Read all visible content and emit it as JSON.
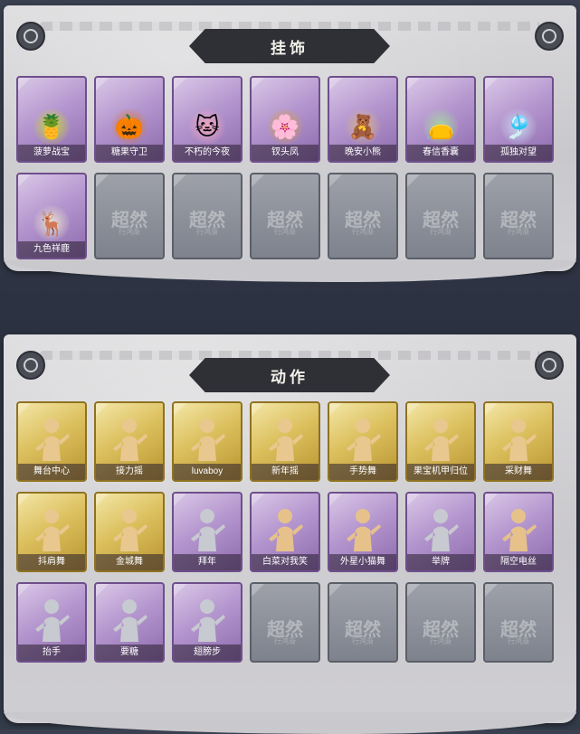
{
  "pendants": {
    "title": "挂饰",
    "items": [
      {
        "label": "菠萝战宝",
        "icon": "pineapple-warrior-icon",
        "glyph": "🍍",
        "color": "#c9d832"
      },
      {
        "label": "糖果守卫",
        "icon": "pumpkin-guard-icon",
        "glyph": "🎃",
        "color": "#e07a2e"
      },
      {
        "label": "不朽的今夜",
        "icon": "pink-cat-icon",
        "glyph": "🐱",
        "color": "#f0a6c0"
      },
      {
        "label": "钗头凤",
        "icon": "phoenix-hairpin-icon",
        "glyph": "🌸",
        "color": "#d8a24a"
      },
      {
        "label": "晚安小熊",
        "icon": "bear-icon",
        "glyph": "🧸",
        "color": "#d6b48a"
      },
      {
        "label": "春信香囊",
        "icon": "sachet-icon",
        "glyph": "👝",
        "color": "#a6d8a0"
      },
      {
        "label": "孤独对望",
        "icon": "lonely-gaze-icon",
        "glyph": "🎐",
        "color": "#c8d6f0"
      },
      {
        "label": "九色祥鹿",
        "icon": "deer-icon",
        "glyph": "🦌",
        "color": "#e8e0d0"
      }
    ],
    "empty_slots": 6,
    "watermark": "超然",
    "watermark_sub": "行鸿渐"
  },
  "actions": {
    "title": "动作",
    "items": [
      {
        "label": "舞台中心",
        "rarity": "gold",
        "icon": "stage-center-pose-icon"
      },
      {
        "label": "接力摇",
        "rarity": "gold",
        "icon": "relay-shake-pose-icon"
      },
      {
        "label": "luvaboy",
        "rarity": "gold",
        "icon": "luvaboy-pose-icon"
      },
      {
        "label": "新年摇",
        "rarity": "gold",
        "icon": "new-year-shake-pose-icon"
      },
      {
        "label": "手势舞",
        "rarity": "gold",
        "icon": "gesture-dance-pose-icon"
      },
      {
        "label": "果宝机甲归位",
        "rarity": "gold",
        "icon": "mecha-pose-icon"
      },
      {
        "label": "采财舞",
        "rarity": "gold",
        "icon": "wealth-dance-pose-icon"
      },
      {
        "label": "抖肩舞",
        "rarity": "gold",
        "icon": "shoulder-dance-pose-icon"
      },
      {
        "label": "金城舞",
        "rarity": "gold",
        "icon": "golden-city-dance-pose-icon"
      },
      {
        "label": "拜年",
        "rarity": "purple",
        "icon": "new-year-greeting-pose-icon"
      },
      {
        "label": "白菜对我笑",
        "rarity": "purple",
        "icon": "cabbage-smile-pose-icon"
      },
      {
        "label": "外星小猫舞",
        "rarity": "purple",
        "icon": "alien-cat-dance-pose-icon"
      },
      {
        "label": "举牌",
        "rarity": "purple",
        "icon": "hold-sign-pose-icon"
      },
      {
        "label": "隔空电丝",
        "rarity": "purple",
        "icon": "air-shock-pose-icon"
      },
      {
        "label": "抬手",
        "rarity": "purple",
        "icon": "raise-hand-pose-icon"
      },
      {
        "label": "要糖",
        "rarity": "purple",
        "icon": "ask-candy-pose-icon"
      },
      {
        "label": "翅膀步",
        "rarity": "purple",
        "icon": "wing-step-pose-icon"
      }
    ],
    "empty_slots": 4
  }
}
